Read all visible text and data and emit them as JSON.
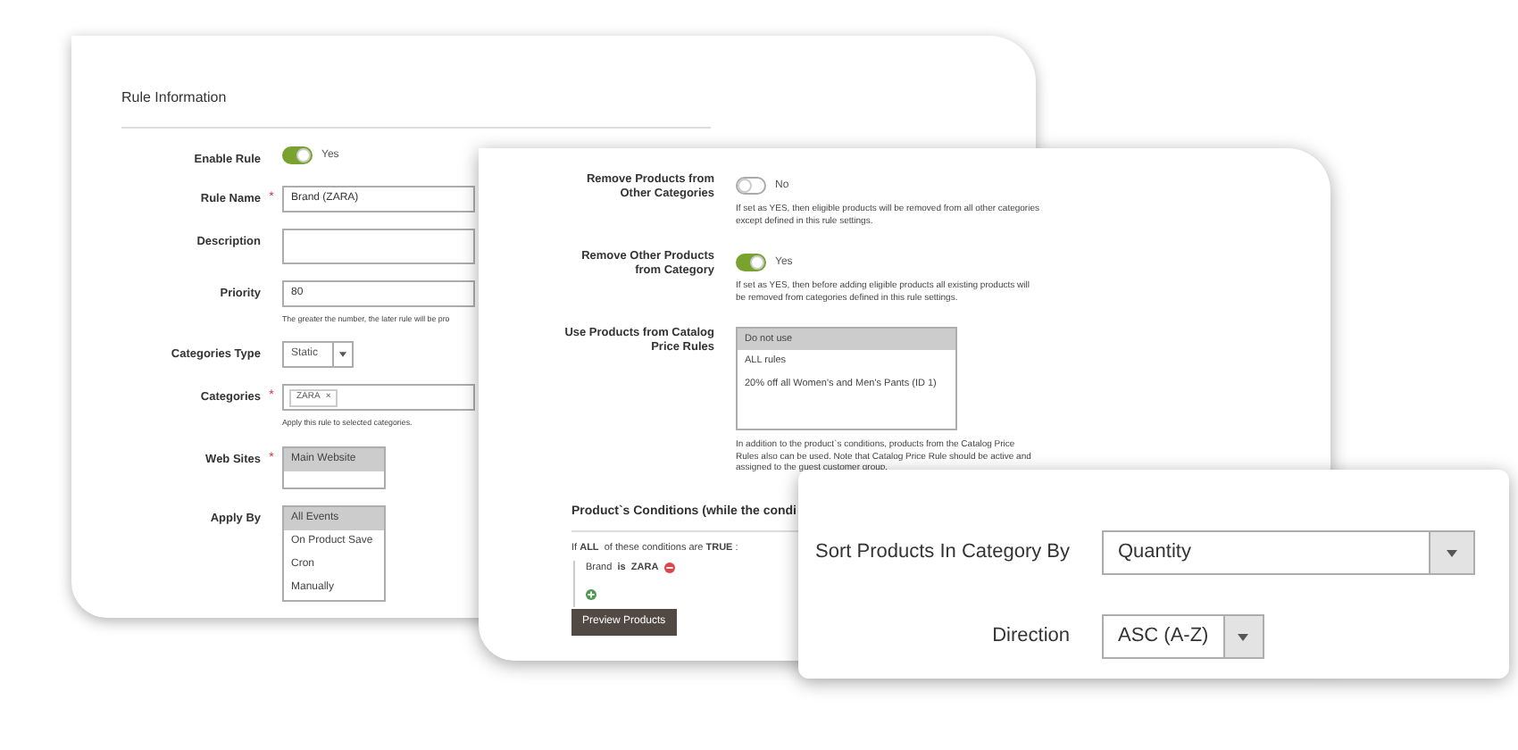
{
  "rule_information": {
    "title": "Rule Information",
    "fields": [
      {
        "kind": "toggle",
        "label": "Enable Rule",
        "on": true,
        "value": "Yes"
      },
      {
        "kind": "text",
        "label": "Rule Name",
        "required_mark": "*",
        "value": "Brand (ZARA)"
      },
      {
        "kind": "textarea",
        "label": "Description"
      },
      {
        "kind": "text",
        "label": "Priority",
        "value": "80",
        "note": "The greater the number, the later rule will be pro"
      },
      {
        "kind": "select",
        "label": "Categories Type",
        "value": "Static"
      },
      {
        "kind": "tags",
        "label": "Categories",
        "required_mark": "*",
        "tags": [
          {
            "label": "ZARA",
            "remove": "×"
          }
        ],
        "note": "Apply this rule to selected categories."
      },
      {
        "kind": "multiselect",
        "label": "Web Sites",
        "required_mark": "*",
        "options": [
          {
            "label": "Main Website",
            "selected": true
          }
        ]
      },
      {
        "kind": "multiselect",
        "label": "Apply By",
        "options": [
          {
            "label": "All Events",
            "selected": true
          },
          {
            "label": "On Product Save",
            "selected": false
          },
          {
            "label": "Cron",
            "selected": false
          },
          {
            "label": "Manually",
            "selected": false
          }
        ]
      }
    ]
  },
  "rule_options": {
    "fields": [
      {
        "kind": "toggle",
        "label": "Remove Products from Other Categories",
        "on": false,
        "value": "No",
        "note": "If set as YES, then eligible products will be removed from all other categories except defined in this rule settings."
      },
      {
        "kind": "toggle",
        "label": "Remove Other Products from Category",
        "on": true,
        "value": "Yes",
        "note": "If set as YES, then before adding eligible products all existing products will be removed from categories defined in this rule settings."
      },
      {
        "kind": "multiselect",
        "label": "Use Products from Catalog Price Rules",
        "options": [
          {
            "label": "Do not use",
            "selected": true
          },
          {
            "label": "ALL rules",
            "selected": false
          },
          {
            "label": "20% off all Women's and Men's Pants (ID 1)",
            "selected": false
          }
        ],
        "note": "In addition to the product`s conditions, products from the Catalog Price Rules also can be used. Note that Catalog Price Rule should be active and assigned to the guest customer group."
      }
    ],
    "conditions": {
      "title": "Product`s Conditions (while the condi",
      "sentence": "If **ALL**  of these conditions are **TRUE** :",
      "condition": "Brand  **is**  **ZARA**",
      "button": "Preview Products"
    }
  },
  "sorting": {
    "fields": [
      {
        "label": "Sort Products In Category By",
        "value": "Quantity"
      },
      {
        "label": "Direction",
        "value": "ASC (A-Z)"
      }
    ]
  }
}
